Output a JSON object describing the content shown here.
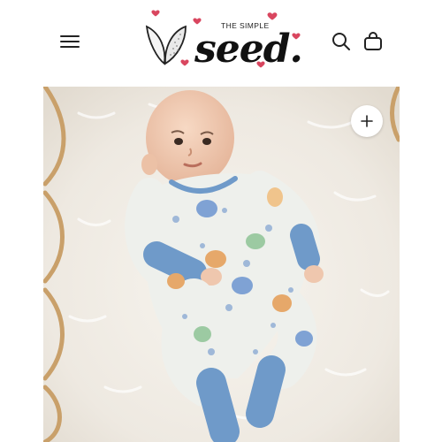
{
  "header": {
    "logo": {
      "top_text": "THE SIMPLE",
      "main_text": "seed."
    },
    "icons": {
      "menu": "hamburger-menu-icon",
      "search": "search-icon",
      "cart": "shopping-bag-icon",
      "zoom": "plus-icon"
    }
  },
  "product_image": {
    "subject": "baby in printed sleeper"
  },
  "colors": {
    "heart": "#d9465f",
    "sleeve_blue": "#6f9ac9",
    "fabric": "#eef0ec"
  }
}
